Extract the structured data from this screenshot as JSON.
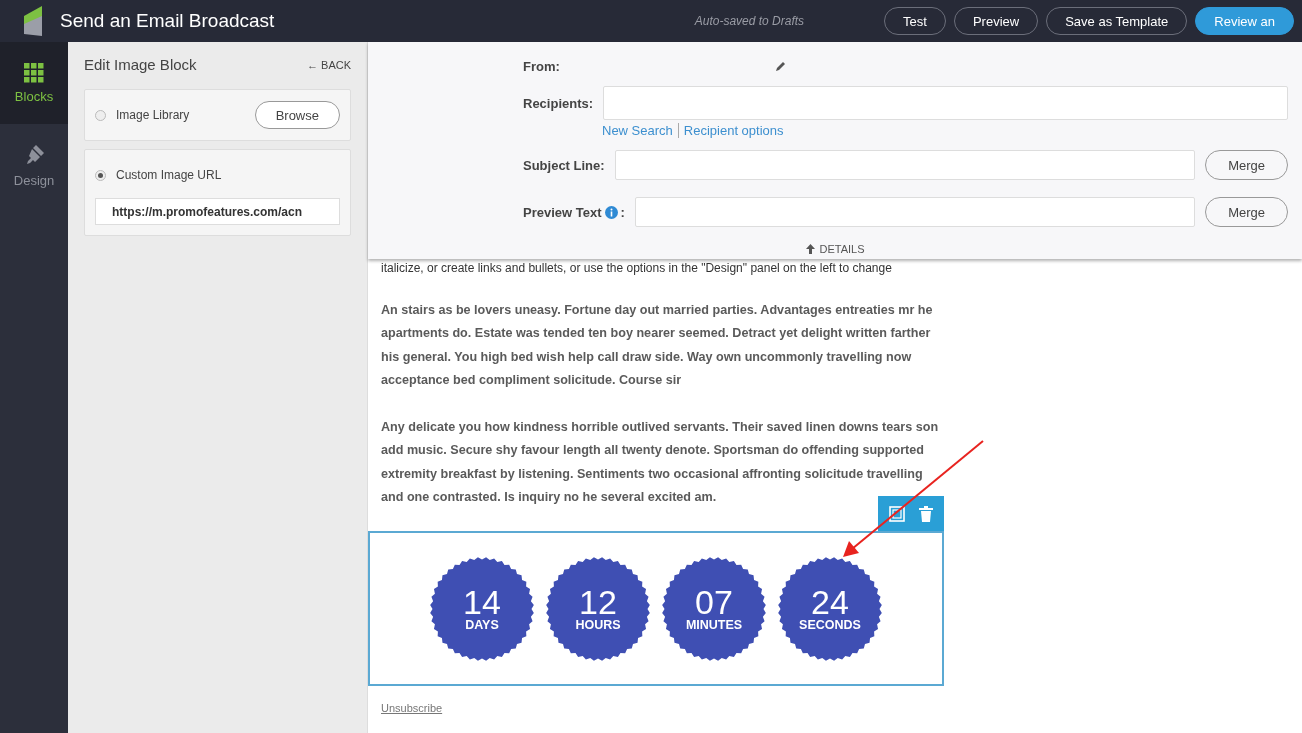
{
  "header": {
    "title": "Send an Email Broadcast",
    "autosave": "Auto-saved to Drafts",
    "buttons": [
      {
        "label": "Test",
        "kind": "outline"
      },
      {
        "label": "Preview",
        "kind": "outline"
      },
      {
        "label": "Save as Template",
        "kind": "outline"
      },
      {
        "label": "Review an",
        "kind": "primary"
      }
    ]
  },
  "rail": [
    {
      "label": "Blocks",
      "kind": "blocks",
      "selected": true
    },
    {
      "label": "Design",
      "kind": "design",
      "selected": false
    }
  ],
  "panel": {
    "title": "Edit Image Block",
    "back": "← BACK",
    "options": [
      {
        "label": "Image Library",
        "selected": false,
        "button": "Browse"
      },
      {
        "label": "Custom Image URL",
        "selected": true,
        "value": "https://m.promofeatures.com/acn"
      }
    ]
  },
  "details": {
    "from_label": "From:",
    "recipients_label": "Recipients:",
    "links": [
      "New Search",
      "Recipient options"
    ],
    "subject_label": "Subject Line:",
    "preview_label": "Preview Text",
    "preview_colon": ":",
    "merge": [
      "Merge",
      "Merge"
    ],
    "toggle": "DETAILS"
  },
  "body": {
    "cut_line": "italicize, or create links and bullets, or use the options in the \"Design\" panel on the left to change",
    "paragraphs": [
      "An stairs as be lovers uneasy. Fortune day out married parties. Advantages entreaties mr he apartments do. Estate was tended ten boy nearer seemed. Detract yet delight written farther his general. You high bed wish help call draw side. Way own uncommonly travelling now acceptance bed compliment solicitude. Course sir",
      "Any delicate you how kindness horrible outlived servants. Their saved linen downs tears son add music. Secure shy favour length all twenty denote. Sportsman do offending supported extremity breakfast by listening. Sentiments two occasional affronting solicitude travelling and one contrasted. Is inquiry no he several excited am."
    ],
    "countdown": [
      {
        "number": "14",
        "unit": "DAYS"
      },
      {
        "number": "12",
        "unit": "HOURS"
      },
      {
        "number": "07",
        "unit": "MINUTES"
      },
      {
        "number": "24",
        "unit": "SECONDS"
      }
    ],
    "unsubscribe": "Unsubscribe"
  }
}
